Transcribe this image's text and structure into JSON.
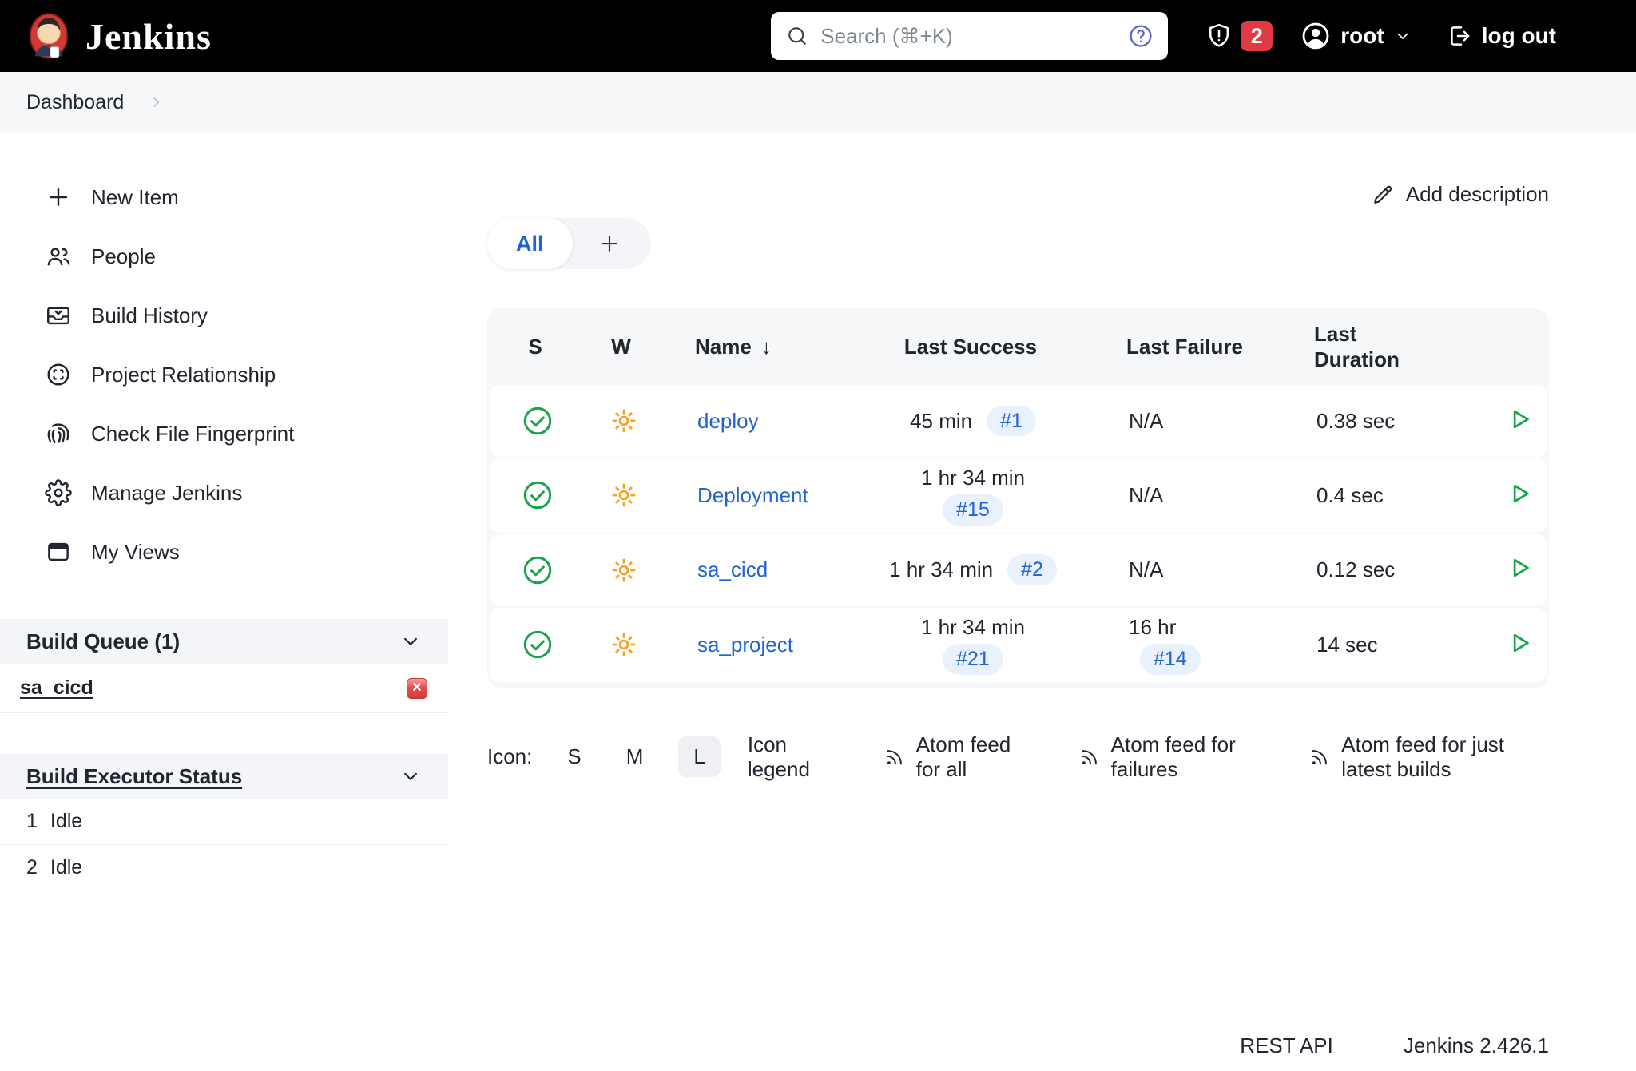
{
  "colors": {
    "topbar_bg": "#000000",
    "accent_blue": "#2065cf",
    "success_green": "#18a34b",
    "weather_amber": "#f2a327",
    "alert_red": "#e03a45",
    "badge_bg": "#e8f1fc",
    "panel_bg": "#f4f5f8",
    "table_bg": "#f6f7f9",
    "help_purple": "#5d62c1"
  },
  "header": {
    "brand": "Jenkins",
    "search": {
      "placeholder": "Search (⌘+K)"
    },
    "notification_count": "2",
    "user_name": "root",
    "logout_label": "log out"
  },
  "breadcrumb": {
    "items": [
      {
        "label": "Dashboard"
      }
    ]
  },
  "sidebar": {
    "items": [
      {
        "label": "New Item",
        "icon": "plus-icon"
      },
      {
        "label": "People",
        "icon": "people-icon"
      },
      {
        "label": "Build History",
        "icon": "build-history-icon"
      },
      {
        "label": "Project Relationship",
        "icon": "project-relationship-icon"
      },
      {
        "label": "Check File Fingerprint",
        "icon": "fingerprint-icon"
      },
      {
        "label": "Manage Jenkins",
        "icon": "gear-icon"
      },
      {
        "label": "My Views",
        "icon": "my-views-icon"
      }
    ],
    "build_queue": {
      "title": "Build Queue (1)",
      "items": [
        {
          "name": "sa_cicd"
        }
      ]
    },
    "executor_status": {
      "title": "Build Executor Status",
      "executors": [
        {
          "number": "1",
          "status": "Idle"
        },
        {
          "number": "2",
          "status": "Idle"
        }
      ]
    }
  },
  "main": {
    "add_description_label": "Add description",
    "view_tabs": {
      "active": "All"
    },
    "table": {
      "columns": {
        "status": "S",
        "weather": "W",
        "name": "Name",
        "last_success": "Last Success",
        "last_failure": "Last Failure",
        "last_duration": "Last Duration"
      },
      "sort_arrow": "↓",
      "rows": [
        {
          "name": "deploy",
          "last_success": "45 min",
          "success_build": "#1",
          "last_failure": "N/A",
          "last_duration": "0.38 sec"
        },
        {
          "name": "Deployment",
          "last_success": "1 hr 34 min",
          "success_build": "#15",
          "last_failure": "N/A",
          "last_duration": "0.4 sec"
        },
        {
          "name": "sa_cicd",
          "last_success": "1 hr 34 min",
          "success_build": "#2",
          "last_failure": "N/A",
          "last_duration": "0.12 sec"
        },
        {
          "name": "sa_project",
          "last_success": "1 hr 34 min",
          "success_build": "#21",
          "last_failure": "16 hr",
          "failure_build": "#14",
          "last_duration": "14 sec"
        }
      ]
    },
    "icon_size_bar": {
      "label": "Icon:",
      "sizes": [
        "S",
        "M",
        "L"
      ],
      "active": "L",
      "legend_label": "Icon legend"
    },
    "feeds": [
      "Atom feed for all",
      "Atom feed for failures",
      "Atom feed for just latest builds"
    ],
    "page_footer": {
      "rest_api": "REST API",
      "version": "Jenkins 2.426.1"
    }
  }
}
